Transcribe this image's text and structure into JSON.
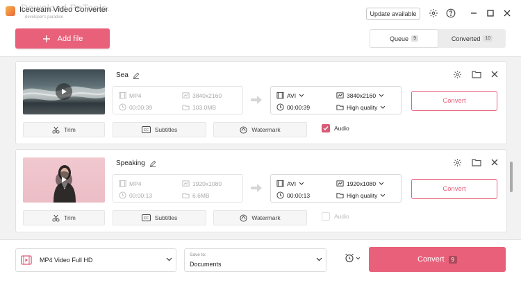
{
  "window": {
    "title": "Icecream Video Converter",
    "subtitle": "developer's paradise",
    "watermark": "Download PeTools.",
    "update_label": "Update available"
  },
  "toolbar": {
    "add_file_label": "Add file",
    "tabs": [
      {
        "label": "Queue",
        "count": "9",
        "active": true
      },
      {
        "label": "Converted",
        "count": "10",
        "active": false
      }
    ]
  },
  "files": [
    {
      "name": "Sea",
      "source": {
        "format": "MP4",
        "resolution": "3840x2160",
        "duration": "00:00:39",
        "size": "103.0MB"
      },
      "output": {
        "format": "AVI",
        "resolution": "3840x2160",
        "duration": "00:00:39",
        "quality": "High quality"
      },
      "convert_label": "Convert",
      "tools": {
        "trim": "Trim",
        "subtitles": "Subtitles",
        "watermark": "Watermark"
      },
      "audio": {
        "label": "Audio",
        "checked": true
      }
    },
    {
      "name": "Speaking",
      "source": {
        "format": "MP4",
        "resolution": "1920x1080",
        "duration": "00:00:13",
        "size": "6.6MB"
      },
      "output": {
        "format": "AVI",
        "resolution": "1920x1080",
        "duration": "00:00:13",
        "quality": "High quality"
      },
      "convert_label": "Convert",
      "tools": {
        "trim": "Trim",
        "subtitles": "Subtitles",
        "watermark": "Watermark"
      },
      "audio": {
        "label": "Audio",
        "checked": false
      }
    }
  ],
  "bottom": {
    "format_preset": "MP4 Video Full HD",
    "save_to_label": "Save to:",
    "save_to_value": "Documents",
    "convert_all_label": "Convert",
    "convert_all_count": "9"
  },
  "colors": {
    "accent": "#e8607a",
    "checkbox": "#d95b76"
  }
}
